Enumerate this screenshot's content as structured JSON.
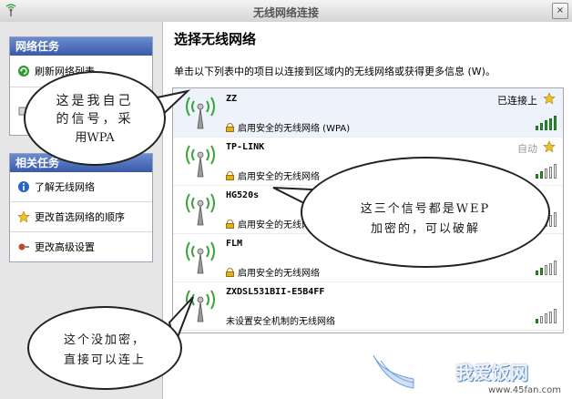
{
  "window": {
    "title": "无线网络连接",
    "close_glyph": "×"
  },
  "sidebar": {
    "network_tasks": {
      "header": "网络任务",
      "items": [
        {
          "label": "刷新网络列表",
          "icon": "refresh-icon"
        },
        {
          "label": "",
          "icon": "wireless-setup-icon"
        }
      ]
    },
    "related_tasks": {
      "header": "相关任务",
      "items": [
        {
          "label": "了解无线网络",
          "icon": "info-icon"
        },
        {
          "label": "更改首选网络的顺序",
          "icon": "star-icon"
        },
        {
          "label": "更改高级设置",
          "icon": "settings-icon"
        }
      ]
    }
  },
  "main": {
    "heading": "选择无线网络",
    "instructions": "单击以下列表中的项目以连接到区域内的无线网络或获得更多信息 (W)。",
    "networks": [
      {
        "ssid": "ZZ",
        "status": "已连接上",
        "security": "启用安全的无线网络 (WPA)",
        "secured": true,
        "signal": 5,
        "starred": true,
        "selected": true
      },
      {
        "ssid": "TP-LINK",
        "status": "自动",
        "security": "启用安全的无线网络",
        "secured": true,
        "signal": 2,
        "starred": true,
        "selected": false
      },
      {
        "ssid": "HG520s",
        "status": "",
        "security": "启用安全的无线网络",
        "secured": true,
        "signal": 2,
        "starred": false,
        "selected": false
      },
      {
        "ssid": "FLM",
        "status": "",
        "security": "启用安全的无线网络",
        "secured": true,
        "signal": 2,
        "starred": false,
        "selected": false
      },
      {
        "ssid": "ZXDSL531BII-E5B4FF",
        "status": "",
        "security": "未设置安全机制的无线网络",
        "secured": false,
        "signal": 1,
        "starred": false,
        "selected": false
      }
    ]
  },
  "annotations": {
    "own_signal": [
      "这是我自己",
      "的信号，采",
      "用WPA"
    ],
    "wep_signals": [
      "这三个信号都是WEP",
      "加密的，可以破解"
    ],
    "open_signal": [
      "这个没加密，",
      "直接可以连上"
    ]
  },
  "watermark": {
    "text": "我爱饭网",
    "url": "www.45fan.com"
  },
  "colors": {
    "header_blue": "#3a5aa8",
    "signal_green": "#2f9a2f",
    "star_yellow": "#f2c224"
  }
}
